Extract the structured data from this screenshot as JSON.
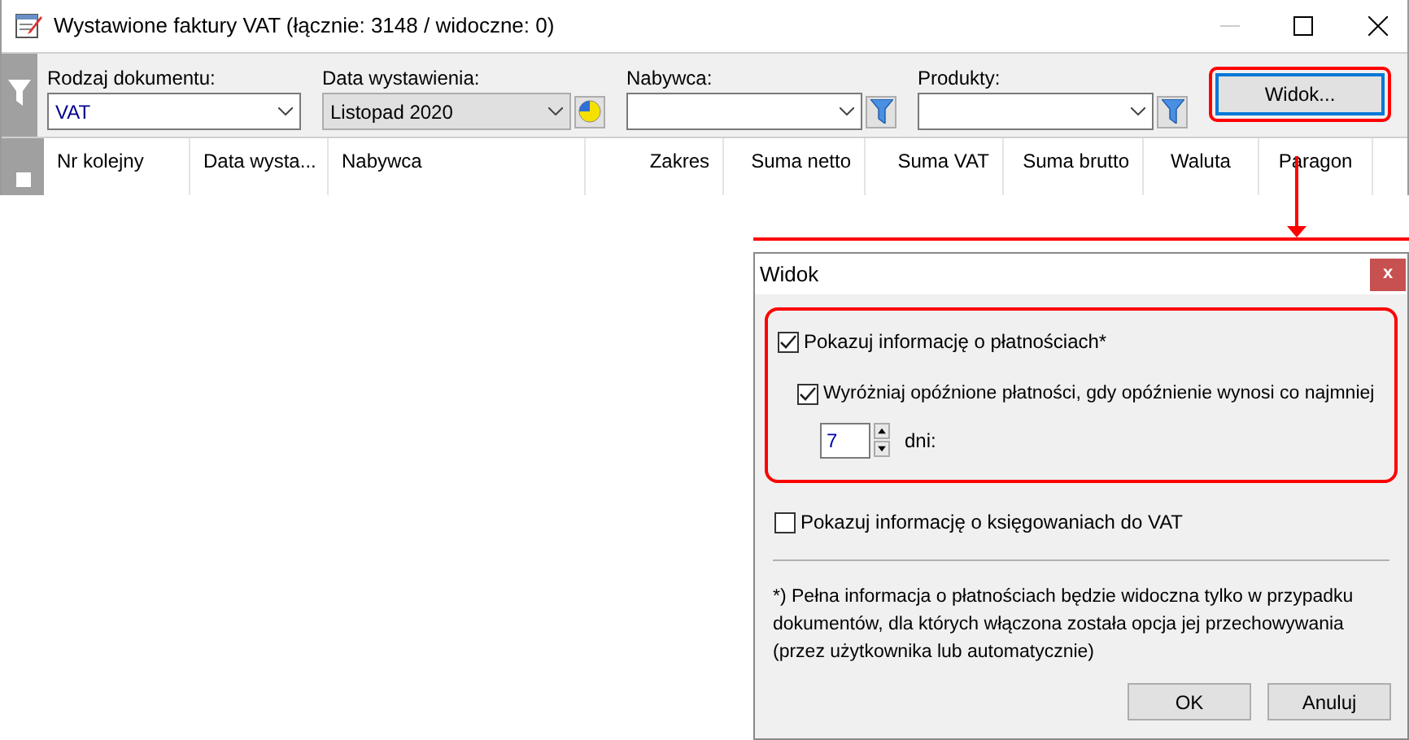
{
  "window": {
    "title": "Wystawione faktury VAT (łącznie: 3148 / widoczne: 0)"
  },
  "filters": [
    {
      "kind": "combo",
      "label": "Rodzaj dokumentu:",
      "value": "VAT",
      "disabled": false
    },
    {
      "kind": "date",
      "label": "Data wystawienia:",
      "value": "Listopad 2020",
      "disabled": true
    },
    {
      "kind": "filter",
      "label": "Nabywca:"
    },
    {
      "kind": "filter",
      "label": "Produkty:"
    }
  ],
  "view_button": {
    "label": "Widok..."
  },
  "table": {
    "select_all": {
      "checked": false
    },
    "columns": [
      "Nr kolejny",
      "Data wysta...",
      "Nabywca",
      "Zakres",
      "Suma netto",
      "Suma VAT",
      "Suma brutto",
      "Waluta",
      "Paragon"
    ]
  },
  "dialog": {
    "title": "Widok",
    "close": "x",
    "payments": {
      "label": "Pokazuj informację o płatnościach*",
      "checked": true,
      "highlight": {
        "label": "Wyróżniaj opóźnione płatności, gdy opóźnienie wynosi co najmniej",
        "checked": true
      },
      "days": {
        "value": "7",
        "unit": "dni:"
      }
    },
    "vat_postings": {
      "label": "Pokazuj informację o księgowaniach do VAT",
      "checked": false
    },
    "note": "*) Pełna informacja o płatnościach będzie widoczna tylko w przypadku dokumentów, dla których włączona została opcja jej przechowywania (przez użytkownika lub automatycznie)",
    "buttons": [
      "OK",
      "Anuluj"
    ]
  }
}
